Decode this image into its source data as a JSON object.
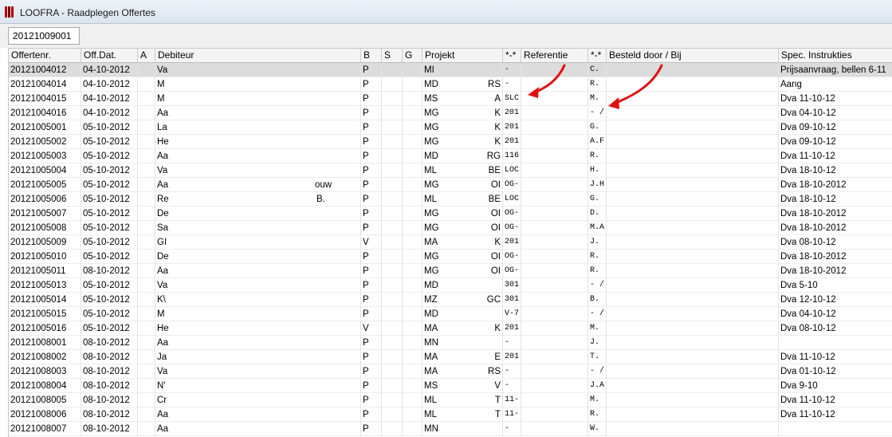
{
  "window": {
    "title": "LOOFRA - Raadplegen Offertes"
  },
  "search": {
    "value": "20121009001"
  },
  "colors": {
    "arrow": "#e01010",
    "selected_row": "#dcdcdc",
    "app_icon": "#b00000"
  },
  "columns": [
    "Offertenr.",
    "Off.Dat.",
    "A",
    "Debiteur",
    "B",
    "S",
    "G",
    "Projekt",
    "*-*",
    "Referentie",
    "*-*",
    "Besteld door / Bij",
    "Spec. Instrukties"
  ],
  "rows": [
    {
      "nr": "20121004012",
      "dat": "04-10-2012",
      "deb": "Va",
      "debx": "",
      "b": "P",
      "proj": "MI",
      "projx": "",
      "ref": "-",
      "bij": "C.",
      "spec": "Prijsaanvraag, bellen 6-11"
    },
    {
      "nr": "20121004014",
      "dat": "04-10-2012",
      "deb": "M",
      "debx": "",
      "b": "P",
      "proj": "MD",
      "projx": "RS",
      "ref": "-",
      "bij": "R.",
      "spec": "Aang"
    },
    {
      "nr": "20121004015",
      "dat": "04-10-2012",
      "deb": "M",
      "debx": "",
      "b": "P",
      "proj": "MS",
      "projx": "A",
      "ref": "SLC",
      "bij": "M.",
      "spec": "Dva 11-10-12"
    },
    {
      "nr": "20121004016",
      "dat": "04-10-2012",
      "deb": "Aa",
      "debx": "",
      "b": "P",
      "proj": "MG",
      "projx": "K",
      "ref": "201",
      "bij": "- /",
      "spec": "Dva 04-10-12"
    },
    {
      "nr": "20121005001",
      "dat": "05-10-2012",
      "deb": "La",
      "debx": "",
      "b": "P",
      "proj": "MG",
      "projx": "K",
      "ref": "201",
      "bij": "G.",
      "spec": "Dva 09-10-12"
    },
    {
      "nr": "20121005002",
      "dat": "05-10-2012",
      "deb": "He",
      "debx": "",
      "b": "P",
      "proj": "MG",
      "projx": "K",
      "ref": "201",
      "bij": "A.F",
      "spec": "Dva 09-10-12"
    },
    {
      "nr": "20121005003",
      "dat": "05-10-2012",
      "deb": "Aa",
      "debx": "",
      "b": "P",
      "proj": "MD",
      "projx": "RG",
      "ref": "116",
      "bij": "R.",
      "spec": "Dva 11-10-12"
    },
    {
      "nr": "20121005004",
      "dat": "05-10-2012",
      "deb": "Va",
      "debx": "",
      "b": "P",
      "proj": "ML",
      "projx": "BE",
      "ref": "LOC",
      "bij": "H.",
      "spec": "Dva 18-10-12"
    },
    {
      "nr": "20121005005",
      "dat": "05-10-2012",
      "deb": "Aa",
      "debx": "ouw",
      "b": "P",
      "proj": "MG",
      "projx": "OI",
      "ref": "OG-",
      "bij": "J.H",
      "spec": "Dva 18-10-2012"
    },
    {
      "nr": "20121005006",
      "dat": "05-10-2012",
      "deb": "Re",
      "debx": "B.",
      "b": "P",
      "proj": "ML",
      "projx": "BE",
      "ref": "LOC",
      "bij": "G.",
      "spec": "Dva 18-10-12"
    },
    {
      "nr": "20121005007",
      "dat": "05-10-2012",
      "deb": "De",
      "debx": "",
      "b": "P",
      "proj": "MG",
      "projx": "OI",
      "ref": "OG-",
      "bij": "D.",
      "spec": "Dva 18-10-2012"
    },
    {
      "nr": "20121005008",
      "dat": "05-10-2012",
      "deb": "Sa",
      "debx": "",
      "b": "P",
      "proj": "MG",
      "projx": "OI",
      "ref": "OG-",
      "bij": "M.A",
      "spec": "Dva 18-10-2012"
    },
    {
      "nr": "20121005009",
      "dat": "05-10-2012",
      "deb": "GI",
      "debx": "",
      "b": "V",
      "proj": "MA",
      "projx": "K",
      "ref": "201",
      "bij": "J.",
      "spec": "Dva 08-10-12"
    },
    {
      "nr": "20121005010",
      "dat": "05-10-2012",
      "deb": "De",
      "debx": "",
      "b": "P",
      "proj": "MG",
      "projx": "OI",
      "ref": "OG-",
      "bij": "R.",
      "spec": "Dva 18-10-2012"
    },
    {
      "nr": "20121005011",
      "dat": "08-10-2012",
      "deb": "Aa",
      "debx": "",
      "b": "P",
      "proj": "MG",
      "projx": "OI",
      "ref": "OG-",
      "bij": "R.",
      "spec": "Dva 18-10-2012"
    },
    {
      "nr": "20121005013",
      "dat": "05-10-2012",
      "deb": "Va",
      "debx": "",
      "b": "P",
      "proj": "MD",
      "projx": "",
      "ref": "301",
      "bij": "- /",
      "spec": "Dva 5-10"
    },
    {
      "nr": "20121005014",
      "dat": "05-10-2012",
      "deb": "K\\",
      "debx": "",
      "b": "P",
      "proj": "MZ",
      "projx": "GC",
      "ref": "301",
      "bij": "B.",
      "spec": "Dva 12-10-12"
    },
    {
      "nr": "20121005015",
      "dat": "05-10-2012",
      "deb": "M",
      "debx": "",
      "b": "P",
      "proj": "MD",
      "projx": "",
      "ref": "V-7",
      "bij": "- /",
      "spec": "Dva 04-10-12"
    },
    {
      "nr": "20121005016",
      "dat": "05-10-2012",
      "deb": "He",
      "debx": "",
      "b": "V",
      "proj": "MA",
      "projx": "K",
      "ref": "201",
      "bij": "M.",
      "spec": "Dva 08-10-12"
    },
    {
      "nr": "20121008001",
      "dat": "08-10-2012",
      "deb": "Aa",
      "debx": "",
      "b": "P",
      "proj": "MN",
      "projx": "",
      "ref": "-",
      "bij": "J.",
      "spec": ""
    },
    {
      "nr": "20121008002",
      "dat": "08-10-2012",
      "deb": "Ja",
      "debx": "",
      "b": "P",
      "proj": "MA",
      "projx": "E",
      "ref": "201",
      "bij": "T.",
      "spec": "Dva 11-10-12"
    },
    {
      "nr": "20121008003",
      "dat": "08-10-2012",
      "deb": "Va",
      "debx": "",
      "b": "P",
      "proj": "MA",
      "projx": "RS",
      "ref": "-",
      "bij": "- /",
      "spec": "Dva 01-10-12"
    },
    {
      "nr": "20121008004",
      "dat": "08-10-2012",
      "deb": "N'",
      "debx": "",
      "b": "P",
      "proj": "MS",
      "projx": "V",
      "ref": "-",
      "bij": "J.A",
      "spec": "Dva 9-10"
    },
    {
      "nr": "20121008005",
      "dat": "08-10-2012",
      "deb": "Cr",
      "debx": "",
      "b": "P",
      "proj": "ML",
      "projx": "T",
      "ref": "11-",
      "bij": "M.",
      "spec": "Dva 11-10-12"
    },
    {
      "nr": "20121008006",
      "dat": "08-10-2012",
      "deb": "Aa",
      "debx": "",
      "b": "P",
      "proj": "ML",
      "projx": "T",
      "ref": "11-",
      "bij": "R.",
      "spec": "Dva 11-10-12"
    },
    {
      "nr": "20121008007",
      "dat": "08-10-2012",
      "deb": "Aa",
      "debx": "",
      "b": "P",
      "proj": "MN",
      "projx": "",
      "ref": "-",
      "bij": "W.",
      "spec": ""
    }
  ]
}
